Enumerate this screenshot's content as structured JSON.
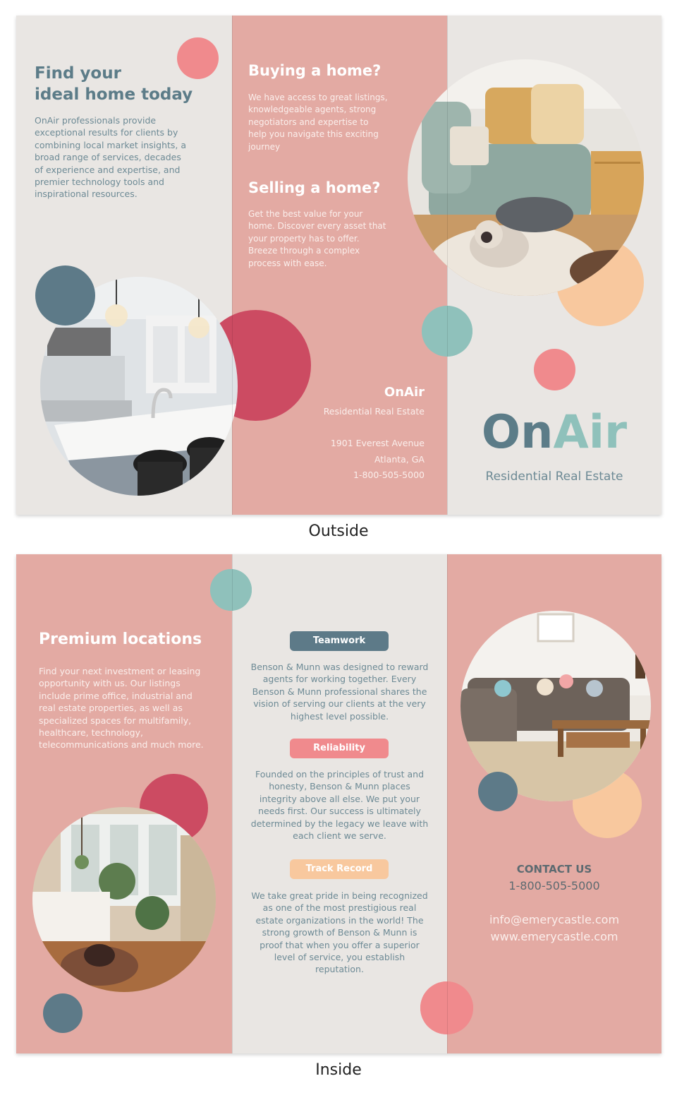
{
  "outside": {
    "caption": "Outside",
    "panel_left": {
      "heading_line1": "Find your",
      "heading_line2": "ideal home today",
      "body": "OnAir professionals provide exceptional results for clients by combining local market insights, a broad range of services, decades of experience and expertise, and premier technology tools and inspirational resources."
    },
    "panel_middle": {
      "buying_heading": "Buying a home?",
      "buying_body": "We have access to great listings, knowledgeable agents, strong negotiators and expertise to help you navigate this exciting journey",
      "selling_heading": "Selling a home?",
      "selling_body": "Get the best value for your home. Discover every asset that your property has to offer. Breeze through a complex process with ease.",
      "company_name": "OnAir",
      "company_tagline": "Residential Real Estate",
      "address_line1": "1901 Everest Avenue",
      "address_line2": "Atlanta, GA",
      "phone": "1-800-505-5000"
    },
    "panel_right": {
      "logo_part1": "On",
      "logo_part2": "Air",
      "logo_tagline": "Residential Real Estate"
    }
  },
  "inside": {
    "caption": "Inside",
    "panel_left": {
      "heading": "Premium locations",
      "body": "Find your next investment or leasing opportunity with us. Our listings include prime office, industrial and real estate properties, as well as specialized spaces for multifamily, healthcare, technology, telecommunications and much more."
    },
    "panel_middle": {
      "sections": [
        {
          "label": "Teamwork",
          "body": "Benson & Munn was designed to reward agents for working together. Every Benson & Munn professional shares the vision of serving our clients at the very highest level possible."
        },
        {
          "label": "Reliability",
          "body": "Founded on the principles of trust and honesty, Benson & Munn places integrity above all else. We put your needs first. Our success is ultimately determined by the legacy we leave with each client we serve."
        },
        {
          "label": "Track Record",
          "body": "We take great pride in being recognized as one of the most prestigious real estate organizations in the world! The strong growth of Benson & Munn is proof that when you offer a superior level of service, you establish reputation."
        }
      ]
    },
    "panel_right": {
      "contact_heading": "CONTACT US",
      "phone": "1-800-505-5000",
      "email": "info@emerycastle.com",
      "website": "www.emerycastle.com"
    }
  },
  "colors": {
    "panel_gray": "#e9e6e3",
    "panel_pink": "#e3aaa3",
    "slate": "#5c7c88",
    "teal": "#8fc1bb",
    "coral": "#f08a8d",
    "crimson": "#cc4b62",
    "peach": "#f8c89e",
    "slate_dot": "#5d7a88"
  },
  "images": {
    "kitchen_photo": "kitchen-photo",
    "living_room_dog_photo": "living-room-dog-photo",
    "sunroom_photo": "sunroom-photo",
    "lounge_photo": "lounge-photo"
  }
}
